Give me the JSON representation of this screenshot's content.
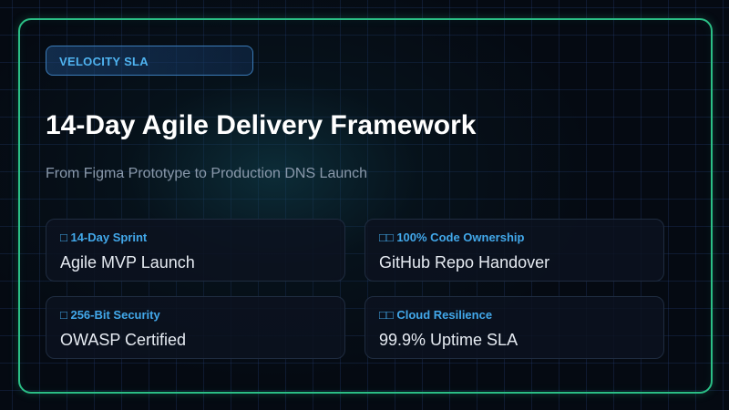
{
  "badge": {
    "label": "VELOCITY SLA"
  },
  "hero": {
    "title": "14-Day Agile Delivery Framework",
    "subtitle": "From Figma Prototype to Production DNS Launch"
  },
  "features": [
    {
      "label": "□ 14-Day Sprint",
      "value": "Agile MVP Launch"
    },
    {
      "label": "□□ 100% Code Ownership",
      "value": "GitHub Repo Handover"
    },
    {
      "label": "□ 256-Bit Security",
      "value": "OWASP Certified"
    },
    {
      "label": "□□ Cloud Resilience",
      "value": "99.9% Uptime SLA"
    }
  ],
  "colors": {
    "accent_frame": "#2bbf86",
    "accent_label": "#42a8ea",
    "background": "#050a12"
  }
}
